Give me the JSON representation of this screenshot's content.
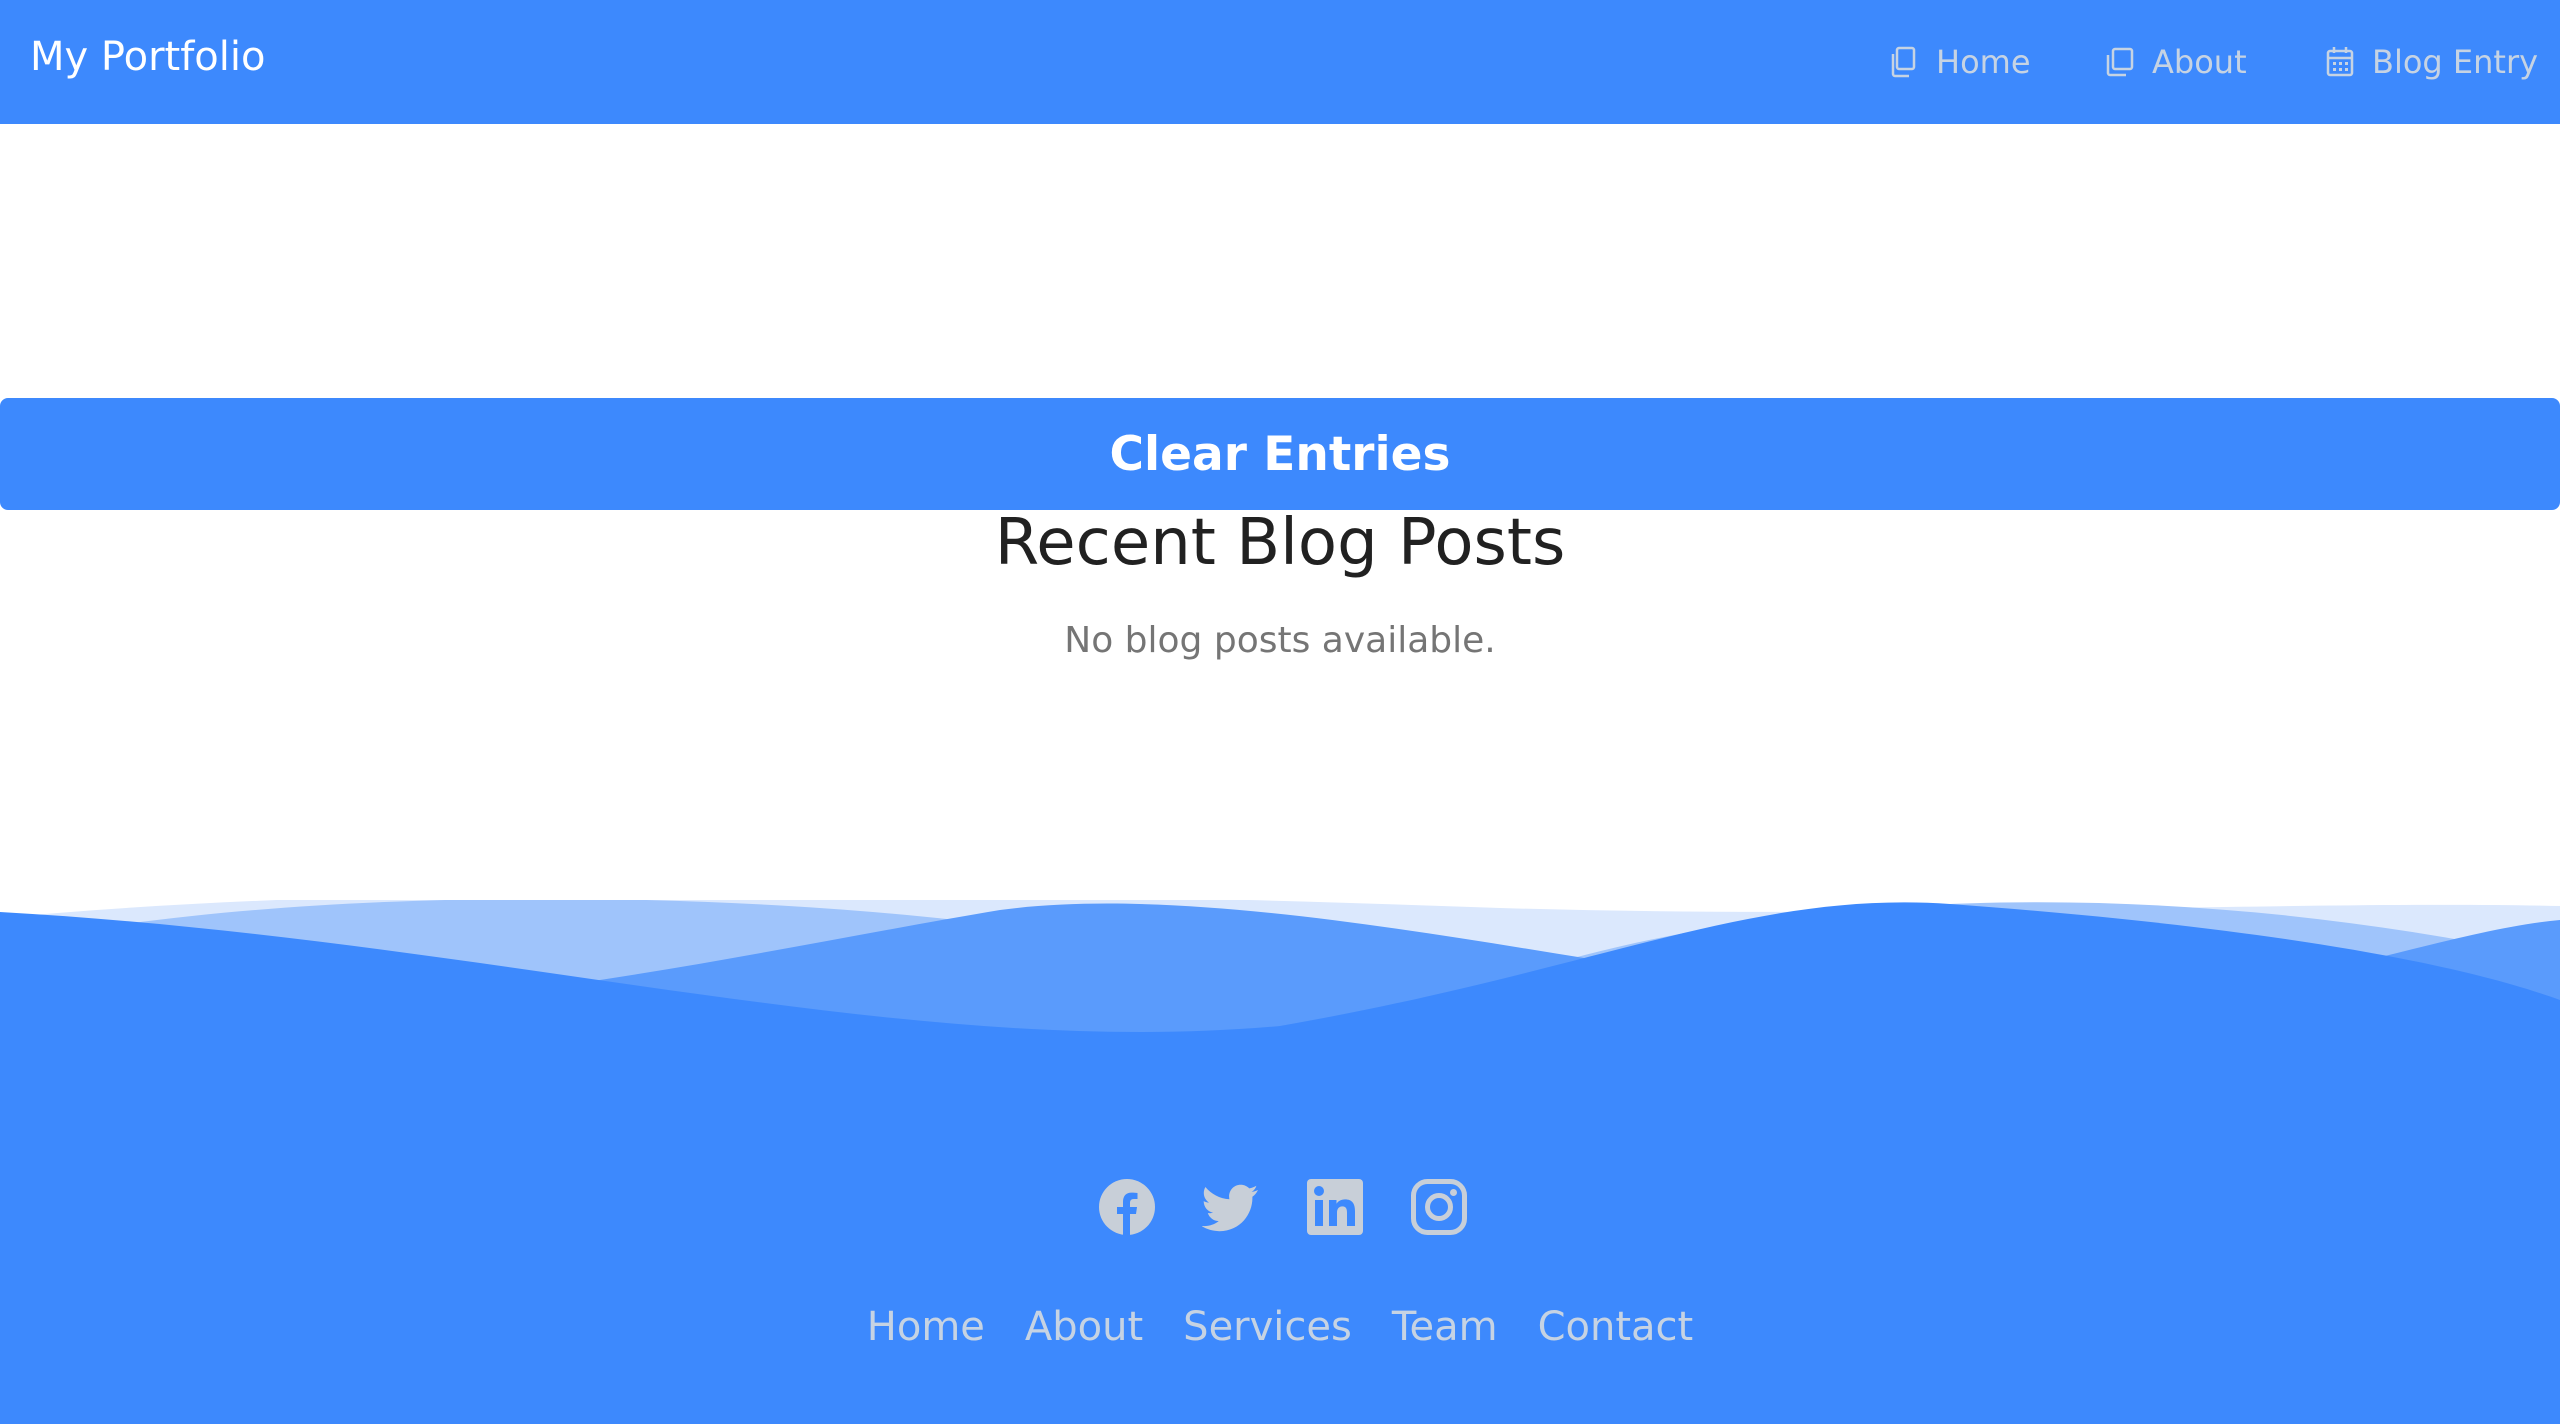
{
  "header": {
    "brand": "My Portfolio",
    "nav": [
      {
        "label": "Home",
        "icon": "copy-icon"
      },
      {
        "label": "About",
        "icon": "window-icon"
      },
      {
        "label": "Blog Entry",
        "icon": "calendar-icon"
      }
    ]
  },
  "main": {
    "clear_button_label": "Clear Entries",
    "heading": "Recent Blog Posts",
    "empty_message": "No blog posts available."
  },
  "footer": {
    "social": [
      "facebook-icon",
      "twitter-icon",
      "linkedin-icon",
      "instagram-icon"
    ],
    "links": [
      "Home",
      "About",
      "Services",
      "Team",
      "Contact"
    ]
  },
  "colors": {
    "accent": "#3d89fd",
    "nav_text": "#c6d3e3",
    "icon_gray": "#c8cfd8",
    "heading_text": "#212121",
    "muted_text": "#757575"
  }
}
